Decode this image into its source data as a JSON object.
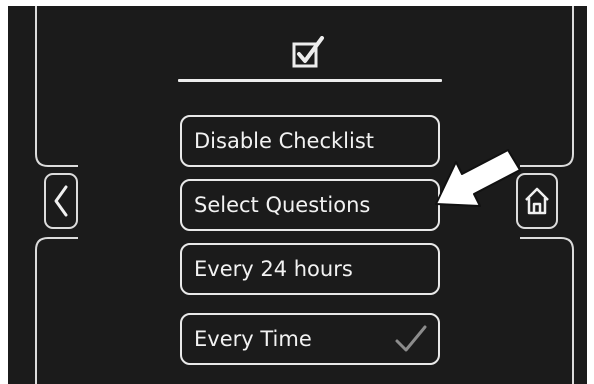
{
  "menu": {
    "items": [
      {
        "label": "Disable Checklist",
        "selected": false
      },
      {
        "label": "Select Questions",
        "selected": false
      },
      {
        "label": "Every 24 hours",
        "selected": false
      },
      {
        "label": "Every Time",
        "selected": true
      }
    ]
  },
  "icons": {
    "header": "checkbox-checked-icon",
    "back": "chevron-left-icon",
    "home": "home-icon",
    "selected": "checkmark-icon",
    "pointer": "white-arrow-icon"
  },
  "colors": {
    "background": "#1b1b1b",
    "foreground": "#e9e9e9",
    "pointer_arrow": "#ffffff",
    "selected_check": "#8c8c8c"
  }
}
